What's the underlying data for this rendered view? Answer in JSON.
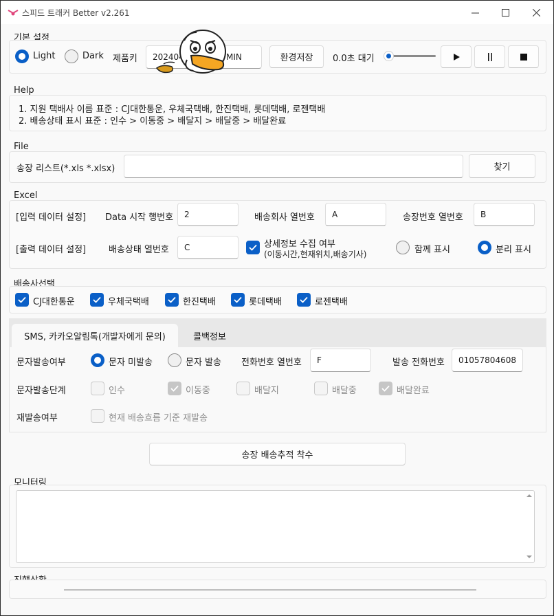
{
  "window": {
    "title": "스피드 트래커 Better v2.261"
  },
  "basic": {
    "label": "기본 설정",
    "theme_light": "Light",
    "theme_dark": "Dark",
    "product_key_label": "제품키",
    "product_key_value": "202404",
    "product_key_suffix": "MIN",
    "save_settings": "환경저장",
    "wait_label": "0.0초 대기",
    "wait_level": 0,
    "play_icon": "play-icon",
    "pause_icon": "pause-icon",
    "stop_icon": "stop-icon"
  },
  "help": {
    "label": "Help",
    "line1": "1. 지원 택배사 이름 표준 : CJ대한통운, 우체국택배, 한진택배, 롯데택배, 로젠택배",
    "line2": "2. 배송상태 표시 표준 : 인수 > 이동중 > 배달지 > 배달중 > 배달완료"
  },
  "file": {
    "label": "File",
    "list_label": "송장 리스트(*.xls *.xlsx)",
    "path_value": "",
    "browse": "찾기"
  },
  "excel": {
    "label": "Excel",
    "input_setting": "[입력 데이터 설정]",
    "start_row_label": "Data 시작 행번호",
    "start_row_value": "2",
    "courier_col_label": "배송회사 열번호",
    "courier_col_value": "A",
    "invoice_col_label": "송장번호 열번호",
    "invoice_col_value": "B",
    "output_setting": "[출력 데이터 설정]",
    "status_col_label": "배송상태 열번호",
    "status_col_value": "C",
    "detail_label_1": "상세정보 수집 여부",
    "detail_label_2": "(이동시간,현재위치,배송기사)",
    "together": "함께 표시",
    "separate": "분리 표시"
  },
  "couriers": {
    "label": "배송사선택",
    "items": [
      "CJ대한통운",
      "우체국택배",
      "한진택배",
      "롯데택배",
      "로젠택배"
    ]
  },
  "tabs": {
    "sms": "SMS, 카카오알림톡(개발자에게 문의)",
    "callback": "콜백정보"
  },
  "sms": {
    "send_label": "문자발송여부",
    "not_send": "문자 미발송",
    "send": "문자 발송",
    "phone_col_label": "전화번호 열번호",
    "phone_col_value": "F",
    "sender_label": "발송 전화번호",
    "sender_value": "01057804608",
    "stage_label": "문자발송단계",
    "stages": [
      "인수",
      "이동중",
      "배달지",
      "배달중",
      "배달완료"
    ],
    "resend_label": "재발송여부",
    "resend_option": "현재 배송흐름 기준 재발송"
  },
  "actions": {
    "start": "송장 배송추적 착수"
  },
  "monitor": {
    "label": "모니터링",
    "content": ""
  },
  "progress": {
    "label": "진행상황",
    "value": 0
  }
}
